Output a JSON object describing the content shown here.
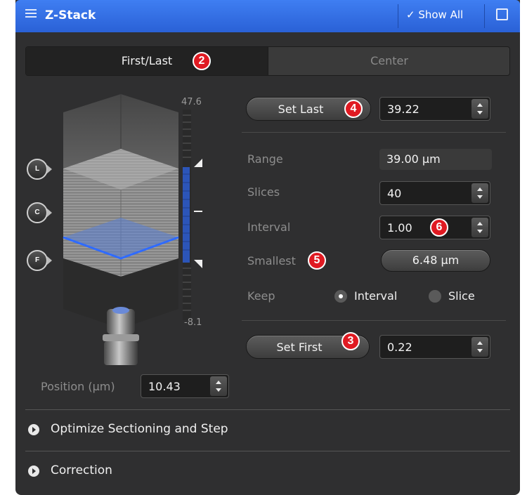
{
  "window": {
    "title": "Z-Stack",
    "show_all_label": "✓ Show All",
    "icon": "list-icon",
    "undock_icon": "undock-icon"
  },
  "tabs": [
    {
      "label": "First/Last",
      "active": true
    },
    {
      "label": "Center",
      "active": false
    }
  ],
  "callouts": {
    "tab": "2",
    "set_last": "4",
    "smallest": "5",
    "interval": "6",
    "set_first": "3"
  },
  "visual": {
    "scale_top": "47.6",
    "scale_bottom": "-8.1",
    "markers": [
      {
        "letter": "L"
      },
      {
        "letter": "C"
      },
      {
        "letter": "F"
      }
    ]
  },
  "set_last": {
    "label": "Set Last",
    "value": "39.22"
  },
  "set_first": {
    "label": "Set First",
    "value": "0.22"
  },
  "params": {
    "range_label": "Range",
    "range_value": "39.00 µm",
    "slices_label": "Slices",
    "slices_value": "40",
    "interval_label": "Interval",
    "interval_value": "1.00",
    "smallest_label": "Smallest",
    "smallest_value": "6.48 µm",
    "keep_label": "Keep",
    "keep_options": [
      {
        "label": "Interval",
        "selected": true
      },
      {
        "label": "Slice",
        "selected": false
      }
    ]
  },
  "position": {
    "label": "Position (µm)",
    "value": "10.43"
  },
  "sections": [
    {
      "label": "Optimize Sectioning and Step"
    },
    {
      "label": "Correction"
    }
  ],
  "colors": {
    "titlebar": "#2f6ae0",
    "panel": "#2f2f30",
    "callout": "#e01a22",
    "focus_plane": "#3a78ff"
  }
}
